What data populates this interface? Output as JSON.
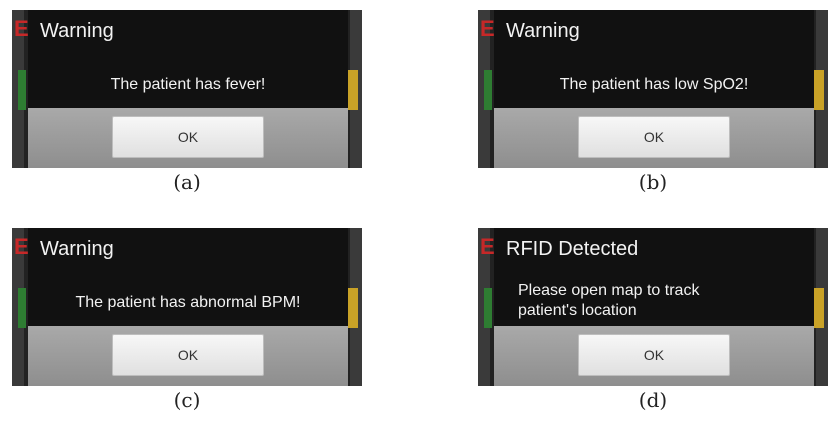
{
  "panels": [
    {
      "caption": "(a)",
      "title": "Warning",
      "message": "The patient has fever!",
      "button": "OK"
    },
    {
      "caption": "(b)",
      "title": "Warning",
      "message": "The patient has low SpO2!",
      "button": "OK"
    },
    {
      "caption": "(c)",
      "title": "Warning",
      "message": "The patient has abnormal BPM!",
      "button": "OK"
    },
    {
      "caption": "(d)",
      "title": "RFID Detected",
      "message_lines": [
        "Please open map to track",
        "patient's location"
      ],
      "button": "OK"
    }
  ],
  "colors": {
    "dialog_bg": "#111111",
    "footer_bg": "#9a9a9a",
    "button_bg": "#efefef",
    "text": "#f2f2f2",
    "accent_red": "#c62828",
    "accent_green": "#2e7d32",
    "accent_yellow": "#c9a227"
  }
}
